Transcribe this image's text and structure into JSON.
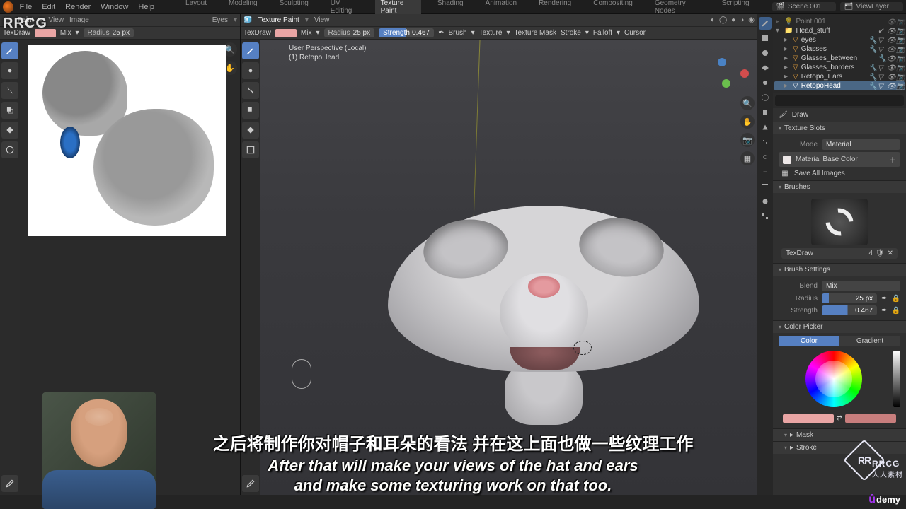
{
  "app": {
    "title": "Blender"
  },
  "menubar": {
    "items": [
      "File",
      "Edit",
      "Render",
      "Window",
      "Help"
    ]
  },
  "scene": {
    "name": "Scene.001",
    "viewlayer": "ViewLayer"
  },
  "workspaces": {
    "tabs": [
      "Layout",
      "Modeling",
      "Sculpting",
      "UV Editing",
      "Texture Paint",
      "Shading",
      "Animation",
      "Rendering",
      "Compositing",
      "Geometry Nodes",
      "Scripting"
    ],
    "active": 4
  },
  "left2d": {
    "header": {
      "mode": "Paint",
      "menus": [
        "View",
        "Image"
      ],
      "object": "Eyes"
    },
    "tool": {
      "color": "#e9a5a4",
      "blend": "Mix",
      "radius_label": "Radius",
      "radius": "25 px"
    },
    "brush": "TexDraw"
  },
  "view3d": {
    "header": {
      "mode": "Texture Paint",
      "menus": [
        "View"
      ]
    },
    "tool": {
      "color": "#e9a5a4",
      "blend": "Mix",
      "radius_label": "Radius",
      "radius": "25 px",
      "strength_label": "Strength",
      "strength": "0.467",
      "menu_items": [
        "Brush",
        "Texture",
        "Texture Mask",
        "Stroke",
        "Falloff",
        "Cursor"
      ]
    },
    "brush": "TexDraw",
    "overlay": {
      "l1": "User Perspective (Local)",
      "l2": "(1) RetopoHead"
    }
  },
  "outliner": {
    "items": [
      {
        "name": "Point.001",
        "icon": "light",
        "indent": 1,
        "sel": false,
        "disabled": true
      },
      {
        "name": "Head_stuff",
        "icon": "collection",
        "indent": 0,
        "sel": false
      },
      {
        "name": "eyes",
        "icon": "mesh",
        "indent": 1,
        "sel": false
      },
      {
        "name": "Glasses",
        "icon": "mesh",
        "indent": 1,
        "sel": false
      },
      {
        "name": "Glasses_between",
        "icon": "mesh",
        "indent": 1,
        "sel": false
      },
      {
        "name": "Glasses_borders",
        "icon": "mesh",
        "indent": 1,
        "sel": false
      },
      {
        "name": "Retopo_Ears",
        "icon": "mesh",
        "indent": 1,
        "sel": false
      },
      {
        "name": "RetopoHead",
        "icon": "mesh",
        "indent": 1,
        "sel": true
      }
    ],
    "search_placeholder": ""
  },
  "active_tool": {
    "label": "Draw"
  },
  "props": {
    "texture_slots": {
      "title": "Texture Slots",
      "mode_label": "Mode",
      "mode": "Material",
      "slot": "Material Base Color",
      "save_all": "Save All Images"
    },
    "brushes": {
      "title": "Brushes",
      "name": "TexDraw",
      "users": "4"
    },
    "brush_settings": {
      "title": "Brush Settings",
      "blend_label": "Blend",
      "blend": "Mix",
      "radius_label": "Radius",
      "radius": "25 px",
      "strength_label": "Strength",
      "strength": "0.467"
    },
    "color_picker": {
      "title": "Color Picker",
      "tabs": [
        "Color",
        "Gradient"
      ],
      "primary": "#e9a5a4",
      "secondary": "#c87e7d"
    },
    "extra": [
      "Mask",
      "Stroke"
    ]
  },
  "subtitles": {
    "cn": "之后将制作你对帽子和耳朵的看法 并在这上面也做一些纹理工作",
    "en1": "After that will make your views of the hat and ears",
    "en2": "and make some texturing work on that too."
  },
  "badges": {
    "tl": "RRCG",
    "corner": "RR",
    "corner_txt": "RRCG",
    "corner_sub": "人人素材",
    "udemy": "ûdemy"
  }
}
